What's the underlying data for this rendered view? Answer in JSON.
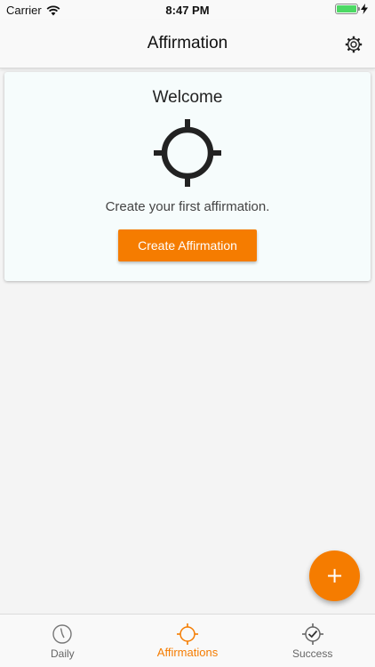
{
  "status_bar": {
    "carrier": "Carrier",
    "time": "8:47 PM"
  },
  "nav": {
    "title": "Affirmation",
    "settings_icon": "gear-icon"
  },
  "welcome_card": {
    "title": "Welcome",
    "icon": "crosshair-target-icon",
    "message": "Create your first affirmation.",
    "button_label": "Create Affirmation"
  },
  "fab": {
    "label": "+"
  },
  "tabs": [
    {
      "label": "Daily",
      "icon": "clock-icon",
      "active": false
    },
    {
      "label": "Affirmations",
      "icon": "crosshair-icon",
      "active": true
    },
    {
      "label": "Success",
      "icon": "check-badge-icon",
      "active": false
    }
  ],
  "colors": {
    "accent": "#f57c00",
    "battery": "#4cd964",
    "card_bg": "#f6fcfc"
  }
}
